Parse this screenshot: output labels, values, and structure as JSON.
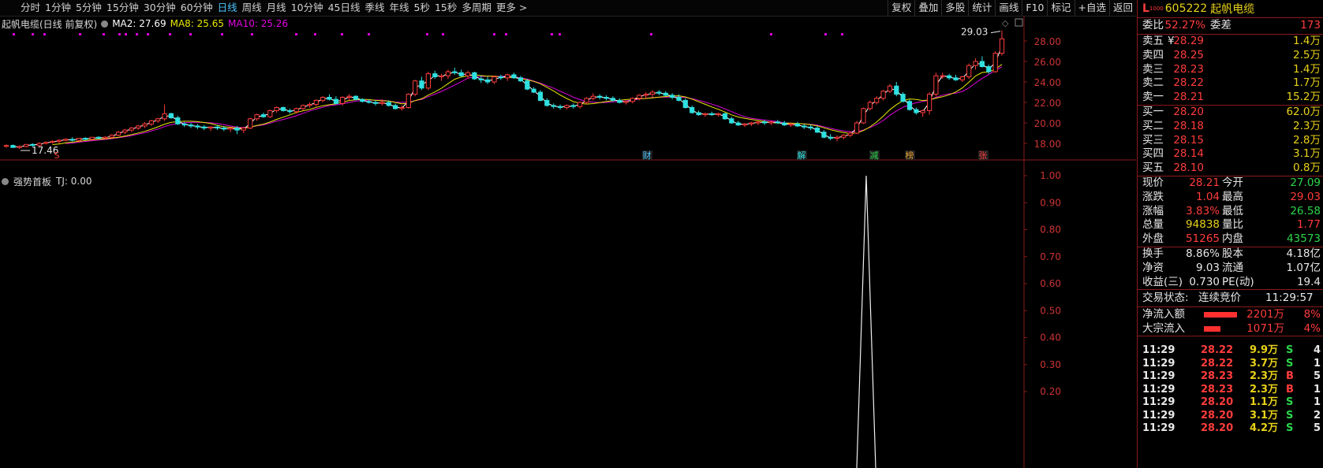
{
  "toolbar": {
    "periods": [
      "分时",
      "1分钟",
      "5分钟",
      "15分钟",
      "30分钟",
      "60分钟",
      "日线",
      "周线",
      "月线",
      "10分钟",
      "45日线",
      "季线",
      "年线",
      "5秒",
      "15秒",
      "多周期",
      "更多 >"
    ],
    "active_period": "日线",
    "tools": [
      "复权",
      "叠加",
      "多股",
      "统计",
      "画线",
      "F10",
      "标记",
      "+自选",
      "返回"
    ]
  },
  "legend": {
    "title": "起帆电缆(日线 前复权)",
    "ma2": "MA2: 27.69",
    "ma8": "MA8: 25.65",
    "ma10": "MA10: 25.26",
    "colors": {
      "ma2": "#ffffff",
      "ma8": "#e8e800",
      "ma10": "#e000e0"
    }
  },
  "indicator": {
    "name": "强势首板",
    "tj": "TJ: 0.00"
  },
  "chart_data": [
    {
      "type": "candlestick",
      "title": "起帆电缆(日线 前复权)",
      "y_ticks": [
        "28.00",
        "26.00",
        "24.00",
        "22.00",
        "20.00",
        "18.00"
      ],
      "ylim": [
        17.6,
        29.9
      ],
      "annotations": {
        "high": "29.03",
        "low": "17.46",
        "events": [
          "S",
          "财",
          "解",
          "减",
          "榜",
          "张"
        ]
      },
      "candles": [
        [
          17.7,
          17.9,
          17.6,
          17.8
        ],
        [
          17.8,
          17.9,
          17.6,
          17.6
        ],
        [
          17.6,
          17.8,
          17.46,
          17.7
        ],
        [
          17.7,
          17.9,
          17.6,
          17.9
        ],
        [
          17.9,
          18.0,
          17.7,
          17.8
        ],
        [
          17.8,
          18.1,
          17.7,
          18.0
        ],
        [
          18.0,
          18.2,
          17.9,
          18.1
        ],
        [
          18.1,
          18.3,
          18.0,
          18.2
        ],
        [
          18.2,
          18.4,
          18.0,
          18.3
        ],
        [
          18.3,
          18.5,
          18.2,
          18.4
        ],
        [
          18.4,
          18.6,
          18.2,
          18.3
        ],
        [
          18.3,
          18.5,
          18.1,
          18.5
        ],
        [
          18.5,
          18.6,
          18.3,
          18.4
        ],
        [
          18.4,
          18.6,
          18.3,
          18.6
        ],
        [
          18.6,
          18.7,
          18.4,
          18.5
        ],
        [
          18.5,
          18.7,
          18.4,
          18.6
        ],
        [
          18.6,
          18.9,
          18.5,
          18.8
        ],
        [
          18.8,
          19.2,
          18.7,
          19.1
        ],
        [
          19.1,
          19.4,
          18.9,
          19.3
        ],
        [
          19.3,
          19.6,
          19.1,
          19.5
        ],
        [
          19.5,
          19.8,
          19.3,
          19.7
        ],
        [
          19.7,
          20.1,
          19.5,
          19.9
        ],
        [
          19.9,
          20.3,
          19.7,
          20.2
        ],
        [
          20.2,
          20.5,
          20.0,
          20.4
        ],
        [
          20.4,
          21.8,
          20.2,
          20.9
        ],
        [
          20.9,
          21.0,
          20.4,
          20.5
        ],
        [
          20.5,
          20.7,
          19.8,
          19.9
        ],
        [
          19.9,
          20.1,
          19.6,
          19.8
        ],
        [
          19.8,
          20.0,
          19.5,
          19.7
        ],
        [
          19.7,
          19.9,
          19.4,
          19.6
        ],
        [
          19.6,
          19.8,
          19.3,
          19.5
        ],
        [
          19.5,
          19.7,
          19.2,
          19.6
        ],
        [
          19.6,
          19.8,
          19.3,
          19.5
        ],
        [
          19.5,
          19.7,
          19.2,
          19.4
        ],
        [
          19.4,
          19.6,
          19.1,
          19.5
        ],
        [
          19.5,
          19.7,
          18.9,
          19.3
        ],
        [
          19.3,
          19.6,
          19.0,
          19.5
        ],
        [
          19.5,
          20.5,
          19.4,
          20.4
        ],
        [
          20.4,
          20.9,
          20.2,
          20.8
        ],
        [
          20.8,
          21.0,
          20.5,
          20.6
        ],
        [
          20.6,
          21.3,
          20.5,
          21.2
        ],
        [
          21.2,
          21.6,
          21.0,
          21.5
        ],
        [
          21.5,
          21.6,
          21.1,
          21.2
        ],
        [
          21.2,
          21.4,
          20.9,
          21.1
        ],
        [
          21.1,
          21.5,
          20.9,
          21.4
        ],
        [
          21.4,
          21.8,
          21.2,
          21.7
        ],
        [
          21.7,
          22.0,
          21.5,
          21.8
        ],
        [
          21.8,
          22.3,
          21.6,
          22.2
        ],
        [
          22.2,
          22.6,
          22.0,
          22.5
        ],
        [
          22.5,
          22.8,
          22.2,
          22.3
        ],
        [
          22.3,
          22.6,
          21.8,
          21.9
        ],
        [
          21.9,
          22.6,
          21.7,
          22.5
        ],
        [
          22.5,
          22.8,
          22.2,
          22.6
        ],
        [
          22.6,
          22.7,
          22.2,
          22.3
        ],
        [
          22.3,
          22.4,
          22.0,
          22.1
        ],
        [
          22.1,
          22.3,
          21.9,
          22.0
        ],
        [
          22.0,
          22.2,
          21.7,
          21.9
        ],
        [
          21.9,
          22.3,
          21.7,
          22.0
        ],
        [
          22.0,
          22.2,
          21.6,
          21.7
        ],
        [
          21.7,
          21.9,
          21.3,
          21.4
        ],
        [
          21.4,
          21.7,
          21.2,
          21.5
        ],
        [
          21.5,
          22.9,
          21.4,
          22.8
        ],
        [
          22.8,
          24.2,
          22.6,
          24.1
        ],
        [
          24.1,
          24.5,
          23.2,
          23.4
        ],
        [
          23.4,
          25.0,
          23.2,
          24.8
        ],
        [
          24.8,
          25.1,
          24.3,
          24.5
        ],
        [
          24.5,
          24.8,
          24.1,
          24.6
        ],
        [
          24.6,
          25.2,
          24.3,
          25.0
        ],
        [
          25.0,
          25.4,
          24.7,
          24.9
        ],
        [
          24.9,
          25.2,
          24.5,
          24.6
        ],
        [
          24.6,
          25.1,
          24.3,
          24.9
        ],
        [
          24.9,
          25.0,
          24.2,
          24.3
        ],
        [
          24.3,
          24.6,
          23.9,
          24.2
        ],
        [
          24.2,
          24.5,
          23.8,
          24.0
        ],
        [
          24.0,
          24.6,
          23.8,
          24.5
        ],
        [
          24.5,
          24.7,
          24.2,
          24.4
        ],
        [
          24.4,
          24.8,
          24.1,
          24.7
        ],
        [
          24.7,
          24.9,
          24.3,
          24.4
        ],
        [
          24.4,
          24.6,
          24.0,
          24.1
        ],
        [
          24.1,
          24.3,
          23.2,
          23.3
        ],
        [
          23.3,
          23.5,
          22.9,
          23.0
        ],
        [
          23.0,
          23.2,
          22.1,
          22.2
        ],
        [
          22.2,
          22.4,
          21.6,
          21.7
        ],
        [
          21.7,
          21.9,
          21.4,
          21.6
        ],
        [
          21.6,
          21.8,
          21.3,
          21.5
        ],
        [
          21.5,
          21.8,
          21.3,
          21.7
        ],
        [
          21.7,
          21.9,
          21.4,
          21.6
        ],
        [
          21.6,
          22.1,
          21.4,
          22.0
        ],
        [
          22.0,
          22.5,
          21.8,
          22.4
        ],
        [
          22.4,
          22.9,
          22.2,
          22.6
        ],
        [
          22.6,
          22.8,
          22.3,
          22.5
        ],
        [
          22.5,
          22.7,
          22.2,
          22.4
        ],
        [
          22.4,
          22.6,
          22.1,
          22.2
        ],
        [
          22.2,
          22.4,
          21.9,
          22.0
        ],
        [
          22.0,
          22.2,
          21.8,
          22.1
        ],
        [
          22.1,
          22.5,
          21.9,
          22.4
        ],
        [
          22.4,
          22.8,
          22.2,
          22.7
        ],
        [
          22.7,
          23.0,
          22.4,
          22.8
        ],
        [
          22.8,
          23.2,
          22.5,
          23.0
        ],
        [
          23.0,
          23.2,
          22.7,
          22.9
        ],
        [
          22.9,
          23.1,
          22.6,
          22.7
        ],
        [
          22.7,
          22.9,
          22.3,
          22.5
        ],
        [
          22.5,
          22.8,
          22.1,
          22.2
        ],
        [
          22.2,
          22.4,
          21.4,
          21.5
        ],
        [
          21.5,
          21.7,
          20.9,
          21.0
        ],
        [
          21.0,
          21.2,
          20.7,
          20.8
        ],
        [
          20.8,
          21.0,
          20.6,
          20.9
        ],
        [
          20.9,
          21.1,
          20.7,
          20.8
        ],
        [
          20.8,
          21.0,
          20.6,
          20.9
        ],
        [
          20.9,
          21.0,
          20.3,
          20.4
        ],
        [
          20.4,
          20.6,
          19.9,
          20.0
        ],
        [
          20.0,
          20.2,
          19.7,
          19.8
        ],
        [
          19.8,
          20.0,
          19.6,
          19.9
        ],
        [
          19.9,
          20.1,
          19.7,
          20.0
        ],
        [
          20.0,
          20.2,
          19.8,
          20.1
        ],
        [
          20.1,
          20.3,
          19.8,
          20.0
        ],
        [
          20.0,
          20.2,
          19.8,
          20.1
        ],
        [
          20.1,
          20.3,
          19.9,
          20.0
        ],
        [
          20.0,
          20.2,
          19.7,
          19.8
        ],
        [
          19.8,
          20.0,
          19.6,
          19.9
        ],
        [
          19.9,
          20.1,
          19.6,
          19.7
        ],
        [
          19.7,
          19.9,
          19.4,
          19.6
        ],
        [
          19.6,
          19.8,
          19.3,
          19.5
        ],
        [
          19.5,
          19.7,
          19.0,
          19.1
        ],
        [
          19.1,
          19.3,
          18.5,
          18.6
        ],
        [
          18.6,
          18.9,
          18.3,
          18.5
        ],
        [
          18.5,
          18.8,
          18.2,
          18.6
        ],
        [
          18.6,
          18.9,
          18.4,
          18.8
        ],
        [
          18.8,
          19.2,
          18.6,
          19.0
        ],
        [
          19.0,
          20.2,
          18.9,
          20.0
        ],
        [
          20.0,
          21.5,
          19.9,
          21.4
        ],
        [
          21.4,
          22.2,
          21.2,
          22.0
        ],
        [
          22.0,
          22.6,
          21.8,
          22.4
        ],
        [
          22.4,
          23.2,
          22.2,
          23.1
        ],
        [
          23.1,
          23.8,
          22.9,
          23.6
        ],
        [
          23.6,
          24.0,
          22.6,
          22.8
        ],
        [
          22.8,
          23.0,
          22.0,
          22.1
        ],
        [
          22.1,
          22.3,
          21.2,
          21.3
        ],
        [
          21.3,
          21.5,
          20.8,
          21.0
        ],
        [
          21.0,
          21.3,
          20.6,
          21.2
        ],
        [
          21.2,
          23.0,
          20.8,
          22.8
        ],
        [
          22.8,
          24.9,
          22.6,
          24.6
        ],
        [
          24.6,
          24.9,
          24.3,
          24.6
        ],
        [
          24.6,
          24.8,
          24.2,
          24.4
        ],
        [
          24.4,
          24.7,
          24.1,
          24.2
        ],
        [
          24.2,
          24.6,
          24.0,
          24.5
        ],
        [
          24.5,
          25.8,
          24.3,
          25.6
        ],
        [
          25.6,
          26.3,
          25.2,
          26.0
        ],
        [
          26.0,
          26.5,
          25.4,
          25.5
        ],
        [
          25.5,
          25.7,
          24.8,
          25.0
        ],
        [
          25.0,
          27.0,
          24.9,
          26.8
        ],
        [
          26.8,
          29.03,
          26.58,
          28.21
        ]
      ],
      "ma2": [],
      "ma8": [],
      "ma10": []
    },
    {
      "type": "line",
      "title": "强势首板",
      "y_ticks": [
        "1.00",
        "0.90",
        "0.80",
        "0.70",
        "0.60",
        "0.50",
        "0.40",
        "0.30",
        "0.20"
      ],
      "spike_index": 141,
      "spike_value": 1.0
    }
  ],
  "quote": {
    "code": "605222",
    "name": "起帆电缆",
    "weibi_label": "委比",
    "weibi": "52.27%",
    "weicha_label": "委差",
    "weicha": "173",
    "sell": [
      {
        "label": "卖五",
        "mark": "¥",
        "price": "28.29",
        "vol": "1.4万"
      },
      {
        "label": "卖四",
        "mark": "",
        "price": "28.25",
        "vol": "2.5万"
      },
      {
        "label": "卖三",
        "mark": "",
        "price": "28.23",
        "vol": "1.4万"
      },
      {
        "label": "卖二",
        "mark": "",
        "price": "28.22",
        "vol": "1.7万"
      },
      {
        "label": "卖一",
        "mark": "",
        "price": "28.21",
        "vol": "15.2万"
      }
    ],
    "buy": [
      {
        "label": "买一",
        "price": "28.20",
        "vol": "62.0万"
      },
      {
        "label": "买二",
        "price": "28.18",
        "vol": "2.3万"
      },
      {
        "label": "买三",
        "price": "28.15",
        "vol": "2.8万"
      },
      {
        "label": "买四",
        "price": "28.14",
        "vol": "3.1万"
      },
      {
        "label": "买五",
        "price": "28.10",
        "vol": "0.8万"
      }
    ],
    "stats": [
      {
        "l1": "现价",
        "v1": "28.21",
        "c1": "red",
        "l2": "今开",
        "v2": "27.09",
        "c2": "green"
      },
      {
        "l1": "涨跌",
        "v1": "1.04",
        "c1": "red",
        "l2": "最高",
        "v2": "29.03",
        "c2": "red"
      },
      {
        "l1": "涨幅",
        "v1": "3.83%",
        "c1": "red",
        "l2": "最低",
        "v2": "26.58",
        "c2": "green"
      },
      {
        "l1": "总量",
        "v1": "94838",
        "c1": "yellow",
        "l2": "量比",
        "v2": "1.77",
        "c2": "red"
      },
      {
        "l1": "外盘",
        "v1": "51265",
        "c1": "red",
        "l2": "内盘",
        "v2": "43573",
        "c2": "green"
      }
    ],
    "fundamentals": [
      {
        "l1": "换手",
        "v1": "8.86%",
        "l2": "股本",
        "v2": "4.18亿"
      },
      {
        "l1": "净资",
        "v1": "9.03",
        "l2": "流通",
        "v2": "1.07亿"
      },
      {
        "l1": "收益(三)",
        "v1": "0.730",
        "l2": "PE(动)",
        "v2": "19.4"
      }
    ],
    "trade_status_label": "交易状态:",
    "trade_status": "连续竞价",
    "trade_time": "11:29:57",
    "flows": [
      {
        "label": "净流入额",
        "value": "2201万",
        "pct": "8%",
        "bar": 0.8
      },
      {
        "label": "大宗流入",
        "value": "1071万",
        "pct": "4%",
        "bar": 0.4
      }
    ],
    "ticks": [
      {
        "time": "11:29",
        "price": "28.22",
        "vol": "9.9万",
        "side": "S",
        "n": "4"
      },
      {
        "time": "11:29",
        "price": "28.22",
        "vol": "3.7万",
        "side": "S",
        "n": "1"
      },
      {
        "time": "11:29",
        "price": "28.23",
        "vol": "2.3万",
        "side": "B",
        "n": "5"
      },
      {
        "time": "11:29",
        "price": "28.23",
        "vol": "2.3万",
        "side": "B",
        "n": "1"
      },
      {
        "time": "11:29",
        "price": "28.20",
        "vol": "1.1万",
        "side": "S",
        "n": "1"
      },
      {
        "time": "11:29",
        "price": "28.20",
        "vol": "3.1万",
        "side": "S",
        "n": "2"
      },
      {
        "time": "11:29",
        "price": "28.20",
        "vol": "4.2万",
        "side": "S",
        "n": "5"
      }
    ]
  }
}
